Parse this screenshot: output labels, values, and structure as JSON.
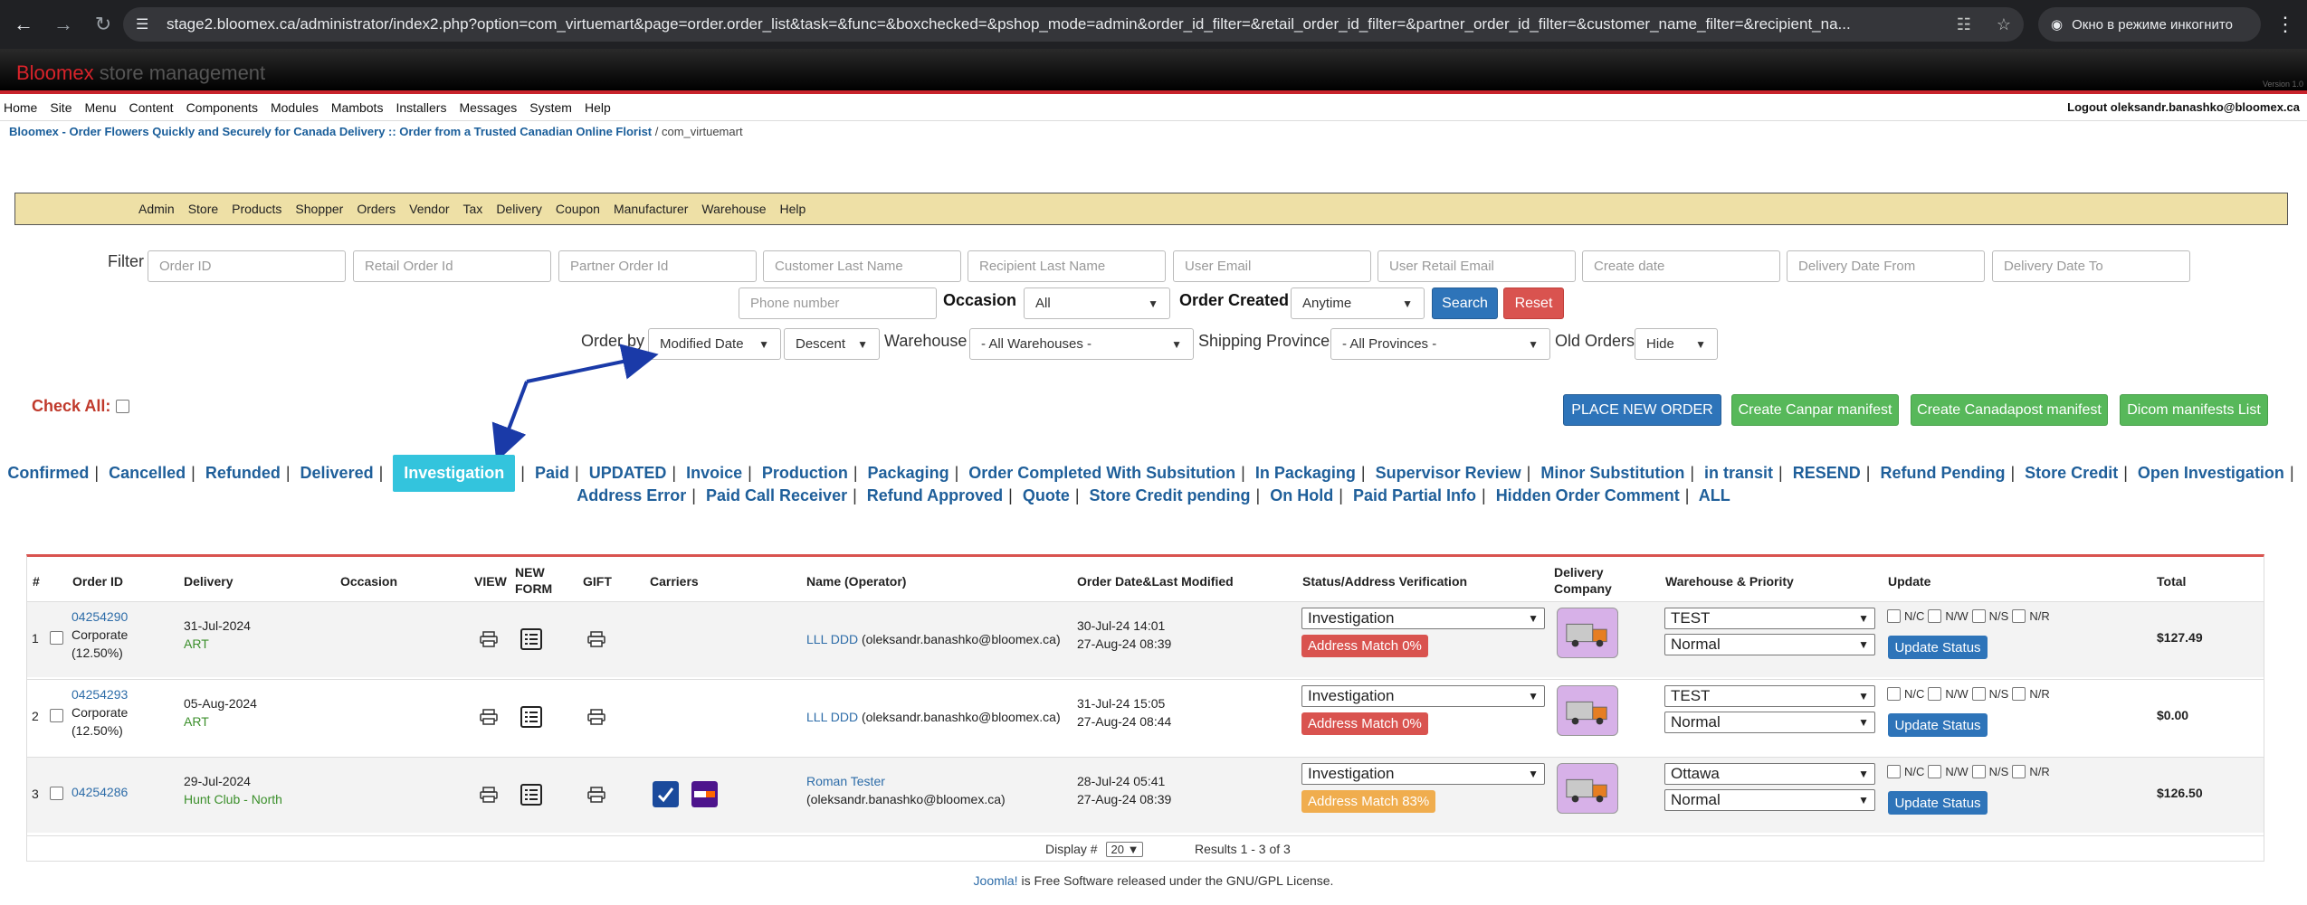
{
  "browser": {
    "url": "stage2.bloomex.ca/administrator/index2.php?option=com_virtuemart&page=order.order_list&task=&func=&boxchecked=&pshop_mode=admin&order_id_filter=&retail_order_id_filter=&partner_order_id_filter=&customer_name_filter=&recipient_na...",
    "incognito_label": "Окно в режиме инкогнито"
  },
  "header": {
    "brand_part1": "Bloomex",
    "brand_part2": "store management",
    "version": "Version 1.0"
  },
  "top_menu": {
    "items": [
      "Home",
      "Site",
      "Menu",
      "Content",
      "Components",
      "Modules",
      "Mambots",
      "Installers",
      "Messages",
      "System",
      "Help"
    ],
    "logout": "Logout oleksandr.banashko@bloomex.ca"
  },
  "breadcrumb": {
    "site": "Bloomex - Order Flowers Quickly and Securely for Canada Delivery :: Order from a Trusted Canadian Online Florist",
    "rest": " / com_virtuemart"
  },
  "vm_menu": [
    "Admin",
    "Store",
    "Products",
    "Shopper",
    "Orders",
    "Vendor",
    "Tax",
    "Delivery",
    "Coupon",
    "Manufacturer",
    "Warehouse",
    "Help"
  ],
  "filter": {
    "label": "Filter",
    "placeholders": {
      "order_id": "Order ID",
      "retail_order_id": "Retail Order Id",
      "partner_order_id": "Partner Order Id",
      "customer_last_name": "Customer Last Name",
      "recipient_last_name": "Recipient Last Name",
      "user_email": "User Email",
      "user_retail_email": "User Retail Email",
      "create_date": "Create date",
      "delivery_date_from": "Delivery Date From",
      "delivery_date_to": "Delivery Date To",
      "phone_number": "Phone number"
    },
    "occasion_label": "Occasion",
    "occasion_value": "All",
    "order_created_label": "Order Created",
    "order_created_value": "Anytime",
    "search_button": "Search",
    "reset_button": "Reset",
    "order_by_label": "Order by",
    "order_by_value": "Modified Date",
    "order_dir_value": "Descent",
    "warehouse_label": "Warehouse",
    "warehouse_value": "- All Warehouses -",
    "shipping_province_label": "Shipping Province",
    "shipping_province_value": "- All Provinces -",
    "old_orders_label": "Old Orders",
    "old_orders_value": "Hide"
  },
  "actions": {
    "check_all": "Check All:",
    "place_new_order": "PLACE NEW ORDER",
    "create_canpar": "Create Canpar manifest",
    "create_canadapost": "Create Canadapost manifest",
    "dicom_list": "Dicom manifests List"
  },
  "status_links": {
    "line1": [
      "Confirmed",
      "Cancelled",
      "Refunded",
      "Delivered",
      "Investigation",
      "Paid",
      "UPDATED",
      "Invoice",
      "Production",
      "Packaging",
      "Order Completed With Subsitution",
      "In Packaging",
      "Supervisor Review",
      "Minor Substitution",
      "in transit",
      "RESEND",
      "Refund Pending",
      "Store Credit",
      "Open Investigation"
    ],
    "line2": [
      "Address Error",
      "Paid Call Receiver",
      "Refund Approved",
      "Quote",
      "Store Credit pending",
      "On Hold",
      "Paid Partial Info",
      "Hidden Order Comment",
      "ALL"
    ],
    "active": "Investigation"
  },
  "table": {
    "headers": {
      "num": "#",
      "order_id": "Order ID",
      "delivery": "Delivery",
      "occasion": "Occasion",
      "view": "VIEW",
      "new_form_1": "NEW",
      "new_form_2": "FORM",
      "gift": "GIFT",
      "carriers": "Carriers",
      "name": "Name (Operator)",
      "order_date": "Order Date&Last Modified",
      "status": "Status/Address Verification",
      "delivery_company_1": "Delivery",
      "delivery_company_2": "Company",
      "warehouse": "Warehouse & Priority",
      "update": "Update",
      "total": "Total"
    },
    "rows": [
      {
        "num": "1",
        "order_id": "04254290",
        "occasion_1": "Corporate",
        "occasion_2": "(12.50%)",
        "delivery_date": "31-Jul-2024",
        "delivery_sub": "ART",
        "name_link": "LLL DDD",
        "operator": " (oleksandr.banashko@bloomex.ca)",
        "order_date": "30-Jul-24 14:01",
        "modified": "27-Aug-24 08:39",
        "status": "Investigation",
        "address_match": "Address Match 0%",
        "warehouse": "TEST",
        "priority": "Normal",
        "total": "$127.49"
      },
      {
        "num": "2",
        "order_id": "04254293",
        "occasion_1": "Corporate",
        "occasion_2": "(12.50%)",
        "delivery_date": "05-Aug-2024",
        "delivery_sub": "ART",
        "name_link": "LLL DDD",
        "operator": " (oleksandr.banashko@bloomex.ca)",
        "order_date": "31-Jul-24 15:05",
        "modified": "27-Aug-24 08:44",
        "status": "Investigation",
        "address_match": "Address Match 0%",
        "warehouse": "TEST",
        "priority": "Normal",
        "total": "$0.00"
      },
      {
        "num": "3",
        "order_id": "04254286",
        "occasion_1": "",
        "occasion_2": "",
        "delivery_date": "29-Jul-2024",
        "delivery_sub": "Hunt Club - North",
        "name_link": "Roman Tester",
        "operator": "(oleksandr.banashko@bloomex.ca)",
        "order_date": "28-Jul-24 05:41",
        "modified": "27-Aug-24 08:39",
        "status": "Investigation",
        "address_match": "Address Match 83%",
        "warehouse": "Ottawa",
        "priority": "Normal",
        "total": "$126.50"
      }
    ],
    "update_checks": [
      "N/C",
      "N/W",
      "N/S",
      "N/R"
    ],
    "update_button": "Update Status"
  },
  "footer": {
    "display_label": "Display #",
    "display_value": "20",
    "results": "Results 1 - 3 of 3",
    "joomla_link": "Joomla!",
    "joomla_rest": " is Free Software released under the GNU/GPL License."
  },
  "colors": {
    "accent_red": "#d9534f",
    "active_status": "#33c4dd",
    "link_blue": "#1f5f9a",
    "menu_yellow": "#eee0a6"
  }
}
